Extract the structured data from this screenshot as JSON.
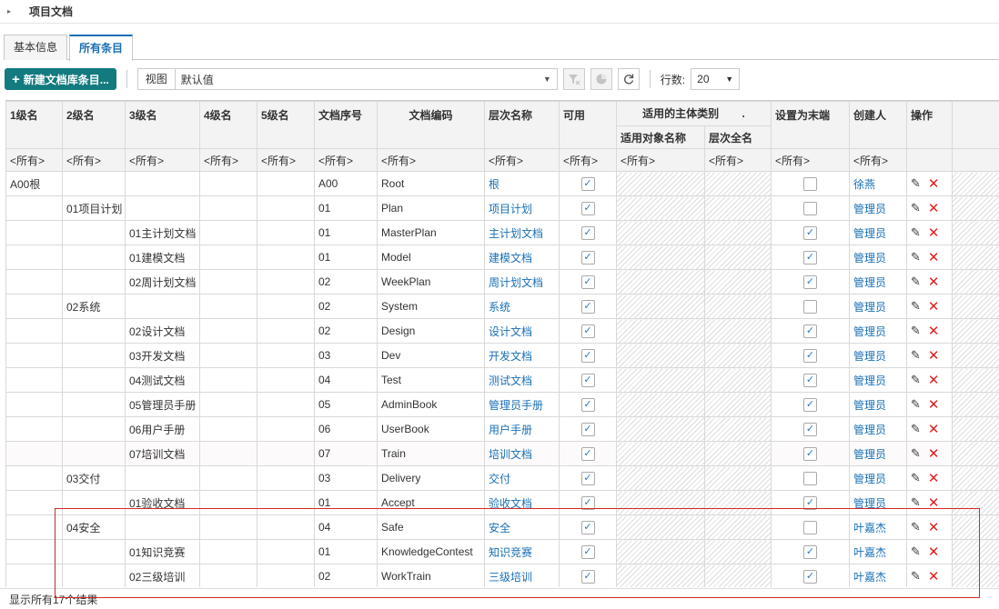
{
  "header": {
    "title": "项目文档"
  },
  "tabs": [
    {
      "label": "基本信息"
    },
    {
      "label": "所有条目"
    }
  ],
  "toolbar": {
    "new_label": "新建文档库条目...",
    "view_label": "视图",
    "view_value": "默认值",
    "rows_label": "行数:",
    "rows_value": "20"
  },
  "columns": {
    "c1": "1级名",
    "c2": "2级名",
    "c3": "3级名",
    "c4": "4级名",
    "c5": "5级名",
    "seq": "文档序号",
    "code": "文档编码",
    "level": "层次名称",
    "enabled": "可用",
    "group": "适用的主体类别",
    "group_dot": ".",
    "sub1": "适用对象名称",
    "sub2": "层次全名",
    "terminal": "设置为末端",
    "creator": "创建人",
    "ops": "操作"
  },
  "filter_text": "<所有>",
  "rows": [
    {
      "l1": "A00根",
      "l2": "",
      "l3": "",
      "seq": "A00",
      "code": "Root",
      "level": "根",
      "enabled": true,
      "terminal": false,
      "creator": "徐燕"
    },
    {
      "l1": "",
      "l2": "01项目计划",
      "l3": "",
      "seq": "01",
      "code": "Plan",
      "level": "项目计划",
      "enabled": true,
      "terminal": false,
      "creator": "管理员"
    },
    {
      "l1": "",
      "l2": "",
      "l3": "01主计划文档",
      "seq": "01",
      "code": "MasterPlan",
      "level": "主计划文档",
      "enabled": true,
      "terminal": true,
      "creator": "管理员"
    },
    {
      "l1": "",
      "l2": "",
      "l3": "01建模文档",
      "seq": "01",
      "code": "Model",
      "level": "建模文档",
      "enabled": true,
      "terminal": true,
      "creator": "管理员"
    },
    {
      "l1": "",
      "l2": "",
      "l3": "02周计划文档",
      "seq": "02",
      "code": "WeekPlan",
      "level": "周计划文档",
      "enabled": true,
      "terminal": true,
      "creator": "管理员"
    },
    {
      "l1": "",
      "l2": "02系统",
      "l3": "",
      "seq": "02",
      "code": "System",
      "level": "系统",
      "enabled": true,
      "terminal": false,
      "creator": "管理员"
    },
    {
      "l1": "",
      "l2": "",
      "l3": "02设计文档",
      "seq": "02",
      "code": "Design",
      "level": "设计文档",
      "enabled": true,
      "terminal": true,
      "creator": "管理员"
    },
    {
      "l1": "",
      "l2": "",
      "l3": "03开发文档",
      "seq": "03",
      "code": "Dev",
      "level": "开发文档",
      "enabled": true,
      "terminal": true,
      "creator": "管理员"
    },
    {
      "l1": "",
      "l2": "",
      "l3": "04测试文档",
      "seq": "04",
      "code": "Test",
      "level": "测试文档",
      "enabled": true,
      "terminal": true,
      "creator": "管理员"
    },
    {
      "l1": "",
      "l2": "",
      "l3": "05管理员手册",
      "seq": "05",
      "code": "AdminBook",
      "level": "管理员手册",
      "enabled": true,
      "terminal": true,
      "creator": "管理员"
    },
    {
      "l1": "",
      "l2": "",
      "l3": "06用户手册",
      "seq": "06",
      "code": "UserBook",
      "level": "用户手册",
      "enabled": true,
      "terminal": true,
      "creator": "管理员"
    },
    {
      "l1": "",
      "l2": "",
      "l3": "07培训文档",
      "seq": "07",
      "code": "Train",
      "level": "培训文档",
      "enabled": true,
      "terminal": true,
      "creator": "管理员"
    },
    {
      "l1": "",
      "l2": "03交付",
      "l3": "",
      "seq": "03",
      "code": "Delivery",
      "level": "交付",
      "enabled": true,
      "terminal": false,
      "creator": "管理员"
    },
    {
      "l1": "",
      "l2": "",
      "l3": "01验收文档",
      "seq": "01",
      "code": "Accept",
      "level": "验收文档",
      "enabled": true,
      "terminal": true,
      "creator": "管理员"
    },
    {
      "l1": "",
      "l2": "04安全",
      "l3": "",
      "seq": "04",
      "code": "Safe",
      "level": "安全",
      "enabled": true,
      "terminal": false,
      "creator": "叶嘉杰"
    },
    {
      "l1": "",
      "l2": "",
      "l3": "01知识竞赛",
      "seq": "01",
      "code": "KnowledgeContest",
      "level": "知识竞赛",
      "enabled": true,
      "terminal": true,
      "creator": "叶嘉杰"
    },
    {
      "l1": "",
      "l2": "",
      "l3": "02三级培训",
      "seq": "02",
      "code": "WorkTrain",
      "level": "三级培训",
      "enabled": true,
      "terminal": true,
      "creator": "叶嘉杰"
    }
  ],
  "status": {
    "text": "显示所有17个结果"
  },
  "icons": {
    "filter_clear": "filter-clear-icon",
    "chart": "chart-icon",
    "refresh": "refresh-icon",
    "edit": "pencil-icon",
    "delete": "delete-x-icon"
  },
  "colors": {
    "primary_button": "#137a7f",
    "link": "#1a6fb5",
    "delete": "#e02020",
    "highlight": "#d42828"
  }
}
